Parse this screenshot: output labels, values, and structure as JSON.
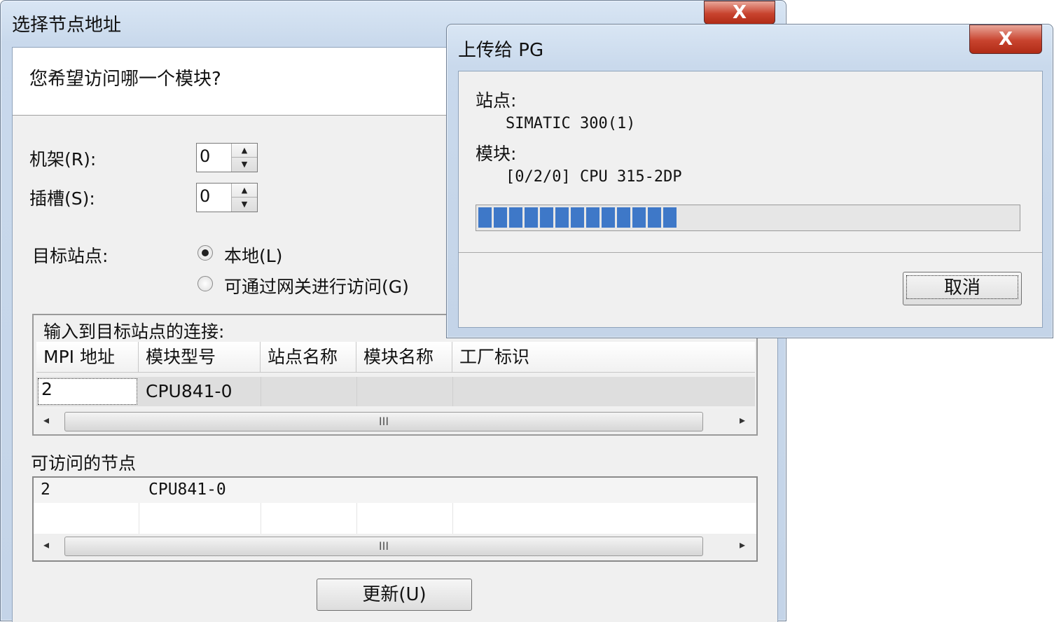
{
  "dialog1": {
    "title": "选择节点地址",
    "close_glyph": "X",
    "question": "您希望访问哪一个模块?",
    "rack_label": "机架(R):",
    "rack_value": "0",
    "slot_label": "插槽(S):",
    "slot_value": "0",
    "target_label": "目标站点:",
    "radio_local": "本地(L)",
    "radio_gateway": "可通过网关进行访问(G)",
    "selected_radio": "local",
    "connection_group_label": "输入到目标站点的连接:",
    "columns": [
      "MPI 地址",
      "模块型号",
      "站点名称",
      "模块名称",
      "工厂标识"
    ],
    "connection_row": [
      "2",
      "CPU841-0",
      "",
      "",
      ""
    ],
    "accessible_nodes_label": "可访问的节点",
    "node_rows": [
      [
        "2",
        "CPU841-0",
        "",
        "",
        ""
      ],
      [
        "",
        "",
        "",
        "",
        ""
      ]
    ],
    "scroll_thumb_glyph": "III",
    "scroll_left_glyph": "◂",
    "scroll_right_glyph": "▸",
    "refresh_button": "更新(U)"
  },
  "dialog2": {
    "title": "上传给 PG",
    "close_glyph": "X",
    "station_label": "站点:",
    "station_value": "SIMATIC 300(1)",
    "module_label": "模块:",
    "module_value": "[0/2/0] CPU 315-2DP",
    "progress_fraction": 0.36,
    "progress_color": "#3e78c8",
    "cancel_button": "取消"
  }
}
